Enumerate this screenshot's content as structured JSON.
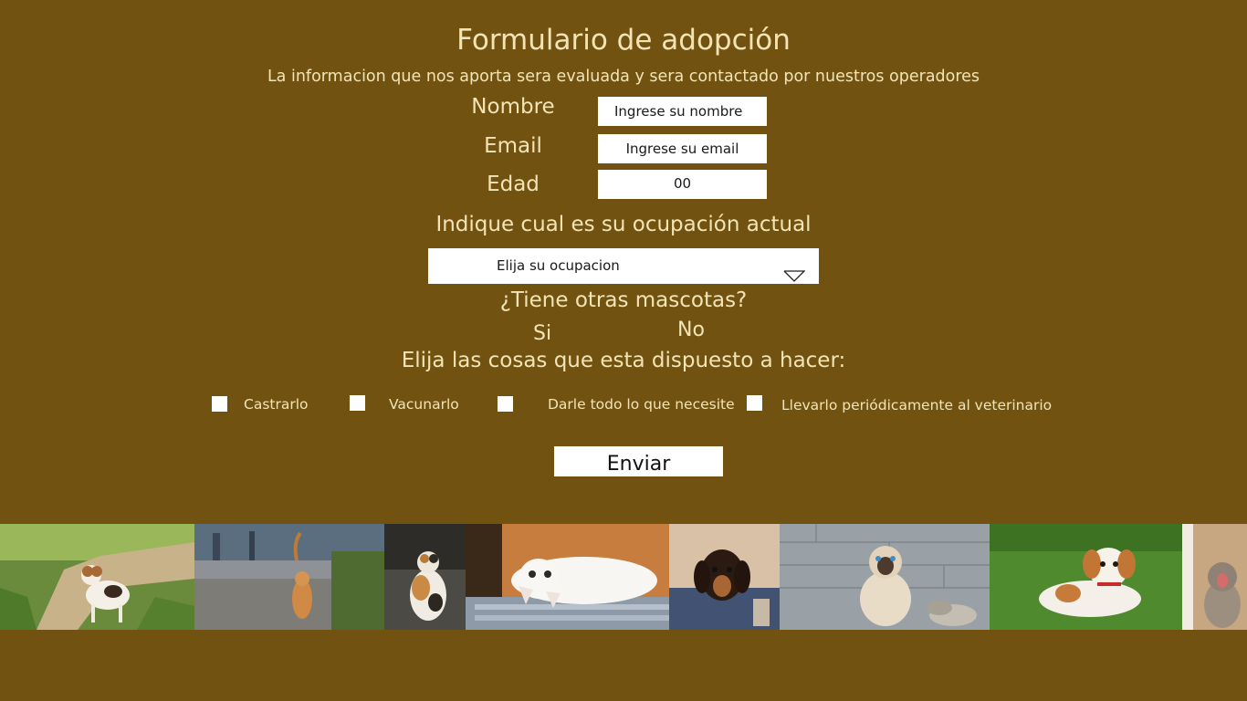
{
  "form": {
    "title": "Formulario de adopción",
    "subtitle": "La informacion que nos aporta sera evaluada y sera contactado por nuestros operadores",
    "name_label": "Nombre",
    "name_value": "Ingrese su nombre",
    "email_label": "Email",
    "email_value": "Ingrese su email",
    "age_label": "Edad",
    "age_value": "00",
    "occupation_question": "Indique cual es su ocupación actual",
    "occupation_selected": "Elija su ocupacion",
    "pets_question": "¿Tiene otras mascotas?",
    "pets_yes": "Si",
    "pets_no": "No",
    "commitments_question": "Elija las cosas que esta dispuesto a hacer:",
    "commitments": [
      "Castrarlo",
      "Vacunarlo",
      "Darle todo lo que necesite",
      "Llevarlo periódicamente al veterinario"
    ],
    "submit_label": "Enviar"
  },
  "colors": {
    "background": "#715211",
    "text": "#f3e4b6",
    "field": "#ffffff"
  },
  "photo_strip": [
    "dog-on-path-photo",
    "cat-walking-photo",
    "calico-cat-photo",
    "white-kitten-photo",
    "dachshund-puppy-photo",
    "siamese-cat-photo",
    "puppy-on-grass-photo",
    "yawning-kitten-photo"
  ]
}
